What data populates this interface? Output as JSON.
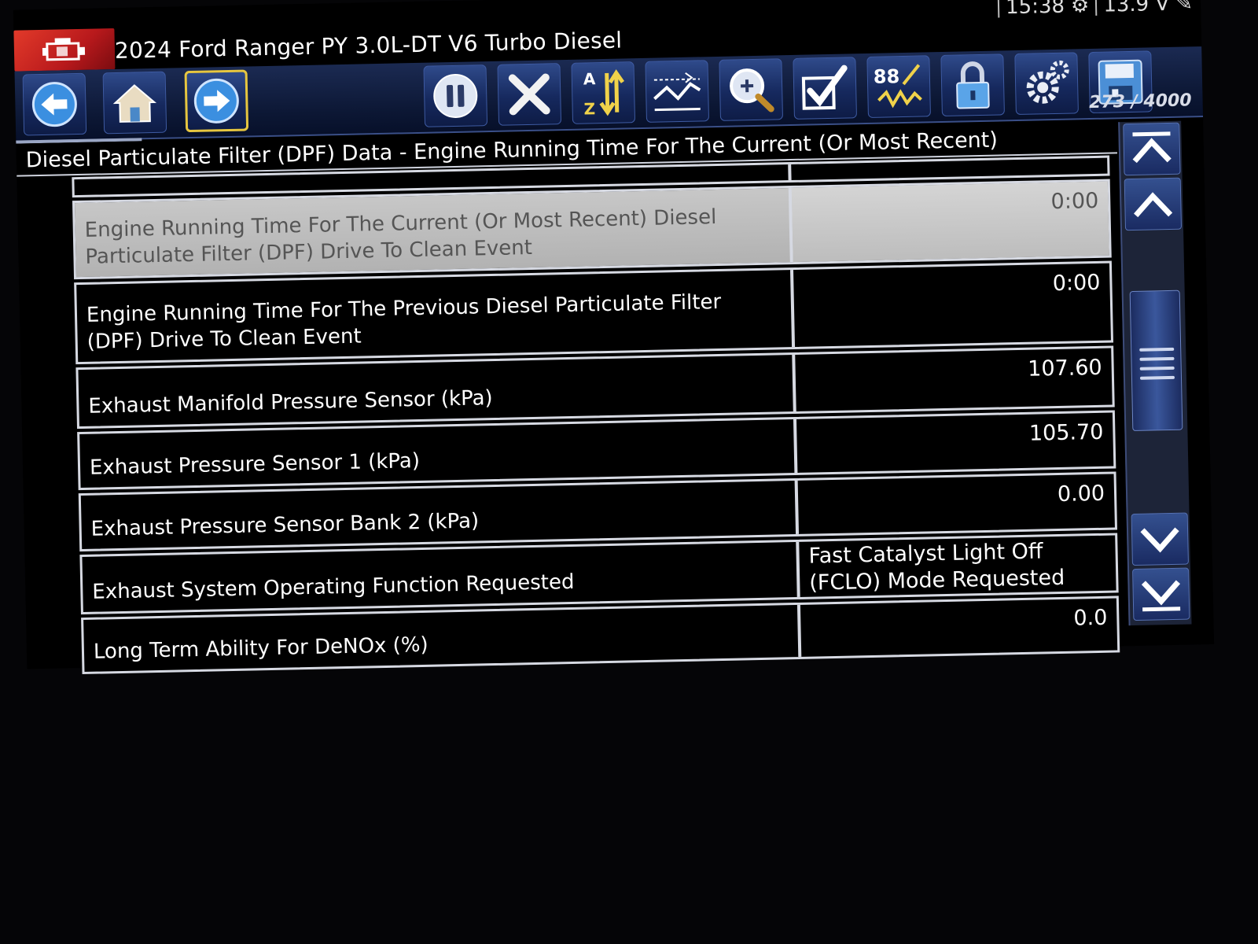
{
  "window": {
    "vehicle_title": "2024 Ford Ranger PY 3.0L-DT V6 Turbo Diesel",
    "clock": "15:38",
    "voltage": "13.9 V"
  },
  "toolbar": {
    "buttons": [
      {
        "name": "back",
        "icon": "back-arrow-icon"
      },
      {
        "name": "home",
        "icon": "home-icon"
      },
      {
        "name": "forward",
        "icon": "forward-arrow-icon",
        "selected": true
      },
      {
        "name": "pause",
        "icon": "pause-icon"
      },
      {
        "name": "clear",
        "icon": "x-icon"
      },
      {
        "name": "sort",
        "icon": "sort-az-icon"
      },
      {
        "name": "graph",
        "icon": "graph-icon"
      },
      {
        "name": "zoom",
        "icon": "zoom-icon"
      },
      {
        "name": "select",
        "icon": "checkmark-icon"
      },
      {
        "name": "pids",
        "icon": "pid-icon",
        "label": "88"
      },
      {
        "name": "lock",
        "icon": "lock-icon"
      },
      {
        "name": "settings",
        "icon": "gear-icon"
      },
      {
        "name": "save",
        "icon": "floppy-disk-icon"
      }
    ]
  },
  "counter": "273 / 4000",
  "header": {
    "text": "Diesel Particulate Filter (DPF) Data - Engine Running Time For The Current (Or Most Recent)"
  },
  "table": {
    "rows": [
      {
        "name": "",
        "value": "",
        "partial": true
      },
      {
        "name": "Engine Running Time For The Current (Or Most Recent) Diesel Particulate Filter (DPF) Drive To Clean Event",
        "value": "0:00",
        "selected": true
      },
      {
        "name": "Engine Running Time For The Previous Diesel Particulate Filter (DPF) Drive To Clean Event",
        "value": "0:00"
      },
      {
        "name": "Exhaust Manifold Pressure Sensor (kPa)",
        "value": "107.60"
      },
      {
        "name": "Exhaust Pressure Sensor 1 (kPa)",
        "value": "105.70"
      },
      {
        "name": "Exhaust Pressure Sensor Bank 2 (kPa)",
        "value": "0.00"
      },
      {
        "name": "Exhaust System Operating Function Requested",
        "value": "Fast Catalyst Light Off (FCLO) Mode Requested",
        "left": true
      },
      {
        "name": "Long Term Ability For DeNOx (%)",
        "value": "0.0"
      }
    ]
  },
  "colors": {
    "toolbar_bg": "#0c1734",
    "button_blue": "#2f4a8a",
    "selected_outline": "#e6c640",
    "logo_red": "#d12a24",
    "row_border": "#d6d9e2",
    "selected_row": "#c0c0c0"
  }
}
